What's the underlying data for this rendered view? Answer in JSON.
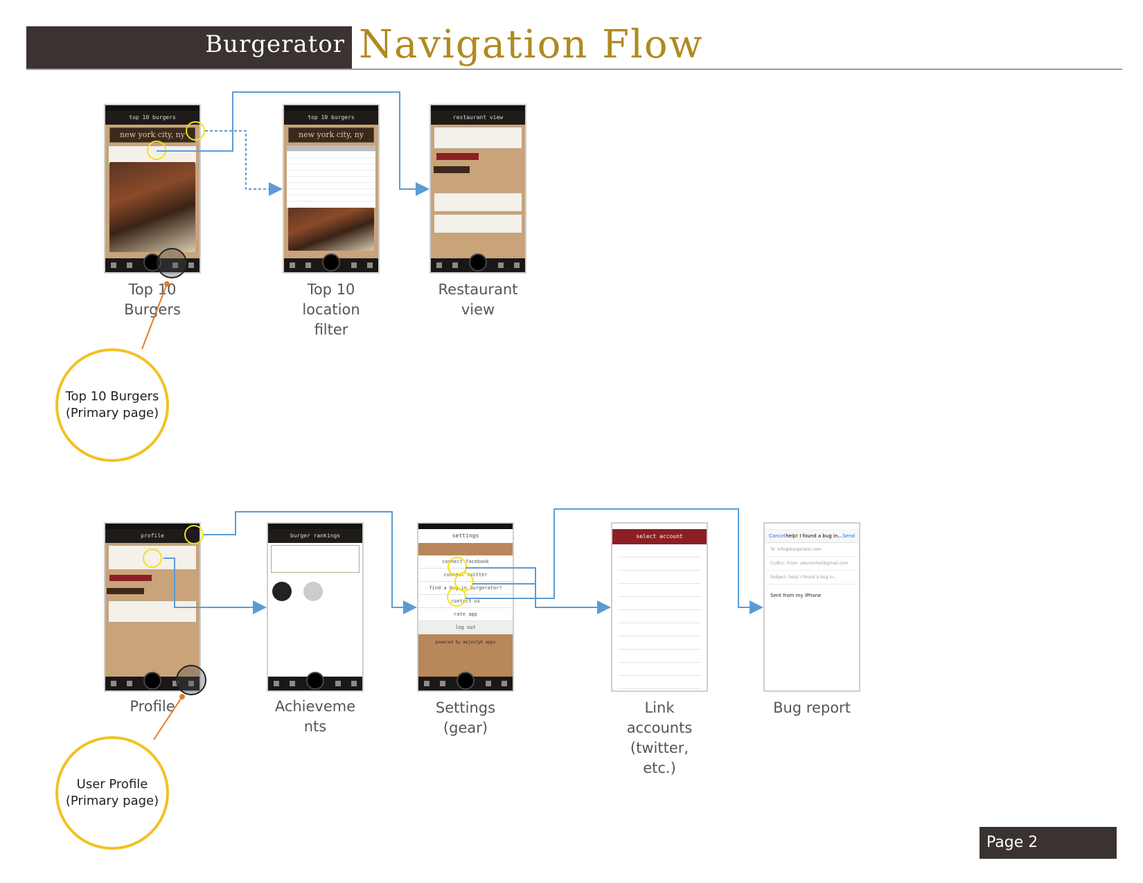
{
  "header": {
    "brand": "Burgerator",
    "title": "Navigation Flow"
  },
  "screens": [
    {
      "id": "top10",
      "caption": "Top 10\nBurgers",
      "nav_title": "top 10 burgers",
      "banner": "new york city, ny"
    },
    {
      "id": "filter",
      "caption": "Top 10\nlocation\nfilter",
      "nav_title": "top 10 burgers",
      "banner": "new york city, ny"
    },
    {
      "id": "restaurant",
      "caption": "Restaurant\nview",
      "nav_title": "restaurant view"
    },
    {
      "id": "profile",
      "caption": "Profile",
      "nav_title": "profile"
    },
    {
      "id": "achievements",
      "caption": "Achieveme\nnts",
      "nav_title": "burger rankings"
    },
    {
      "id": "settings",
      "caption": "Settings\n(gear)",
      "nav_title": "settings",
      "items": [
        "connect facebook",
        "connect twitter",
        "find a bug in burgerator?",
        "contact us",
        "rate app",
        "log out"
      ],
      "footer": "powered by majestyk apps"
    },
    {
      "id": "link",
      "caption": "Link\naccounts\n(twitter,\netc.)",
      "nav_title": "select account"
    },
    {
      "id": "bug",
      "caption": "Bug report",
      "cancel": "Cancel",
      "subject_head": "help! I found a bug in...",
      "send": "Send",
      "to": "To: info@burgerator.com",
      "cc": "Cc/Bcc, From: alecmichel@gmail.com",
      "subject": "Subject: help! I found a bug in...",
      "body": "Sent from my iPhone"
    }
  ],
  "callouts": [
    {
      "id": "top10",
      "text": "Top 10 Burgers\n(Primary page)"
    },
    {
      "id": "profile",
      "text": "User Profile\n(Primary page)"
    }
  ],
  "page_label": "Page 2",
  "colors": {
    "header": "#3a3330",
    "title": "#b08a1e",
    "arrow": "#5b9bd5",
    "callout": "#f2c122",
    "leader": "#e07b2a"
  }
}
